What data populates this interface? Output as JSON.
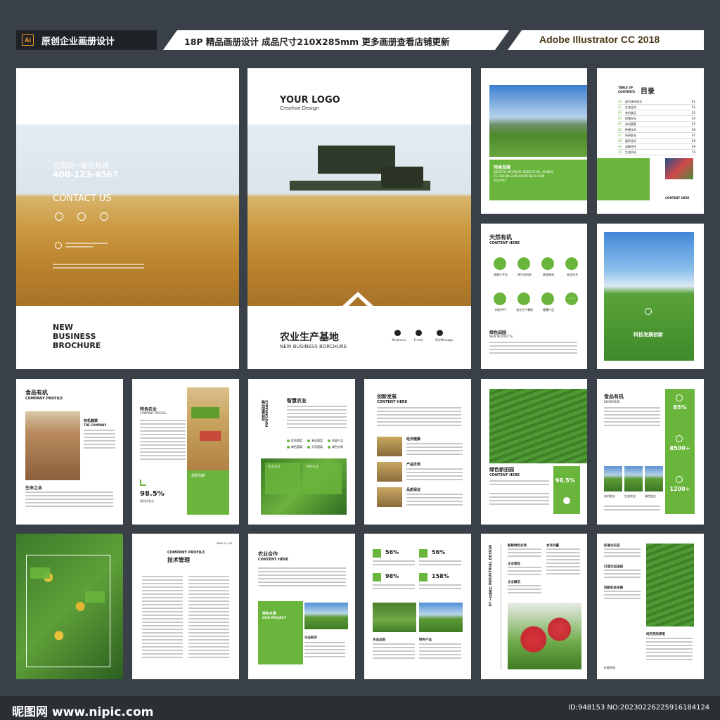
{
  "header": {
    "ai_badge": "Ai",
    "left_title": "原创企业画册设计",
    "middle_title": "18P 精品画册设计  成品尺寸210X285mm  更多画册查看店铺更新",
    "right_title": "Adobe Illustrator CC 2018"
  },
  "pages": {
    "back_cover": {
      "hotline": "全国统一服务热线",
      "phone": "400-123-4567",
      "contact": "CONTACT US",
      "title_line1": "NEW",
      "title_line2": "BUSINESS",
      "title_line3": "BROCHURE"
    },
    "front_cover": {
      "logo": "YOUR LOGO",
      "logo_sub": "Creative Design",
      "title": "农业生产基地",
      "subtitle": "NEW BUSINESS BORCHURE",
      "contact_labels": [
        "Telephone",
        "E-mail",
        "QQ/Message"
      ]
    },
    "p3": {
      "heading": "持续发展",
      "body": "DESITIO NECULPA DEBCATUR, ALIBUS, TE ODION EUM ARUPTIBUS CUM VOLOBE"
    },
    "p4": {
      "label": "TABLE OF CONTENTS",
      "title": "目录",
      "items": [
        "现代休闲农业",
        "生态经济",
        "有机食品",
        "智慧农业",
        "有机蔬菜",
        "种植技术",
        "科研农业",
        "循环经济",
        "战略合作",
        "生态科技"
      ],
      "content_here": "CONTENT HERE"
    },
    "p5": {
      "title": "天然有机",
      "subtitle": "CONTENT HERE",
      "icons": [
        {
          "icon": "leaf-icon",
          "label": "高端大平台"
        },
        {
          "icon": "device-icon",
          "label": "原生态科技"
        },
        {
          "icon": "car-icon",
          "label": "高效物流"
        },
        {
          "icon": "tractor-icon",
          "label": "农业技术"
        },
        {
          "icon": "flask-icon",
          "label": "科技平行"
        },
        {
          "icon": "house-icon",
          "label": "农业生产基地"
        },
        {
          "icon": "gear-icon",
          "label": "健康产品"
        },
        {
          "icon": "more-icon",
          "label": ""
        }
      ],
      "section": "绿色田园",
      "section_sub": "NEW PRODUCTS"
    },
    "p6": {
      "caption": "科技发展创新"
    },
    "p7": {
      "title": "食品有机",
      "subtitle": "COMPANY PROFILE",
      "side_title": "有机蔬菜",
      "side_sub": "THE COMPANY",
      "section": "生命之本"
    },
    "p8": {
      "title": "特色农业",
      "subtitle": "COMPANY PROFILE",
      "stat": "98.5%",
      "stat_label": "高科技农业",
      "caption": "科研创新"
    },
    "p9": {
      "side_title": "非转基因作物",
      "side_sub": "PERFORMANCE",
      "title": "智慧农业",
      "bullets": [
        "优质蔬菜",
        "有机蔬菜",
        "农副产品",
        "绿色蔬菜",
        "天然蔬菜",
        "绿色水果"
      ],
      "box1": "生态农业",
      "box2": "绿色农业"
    },
    "p10": {
      "title": "创新发展",
      "subtitle": "CONTENT HERE",
      "rows": [
        "经济健康",
        "产品优秀",
        "品质保证"
      ]
    },
    "p11": {
      "title": "绿色新田园",
      "subtitle": "CONTENT HERE",
      "stat": "98.5%"
    },
    "p12": {
      "title": "食品有机",
      "subtitle": "REMEMBER",
      "stats": [
        "85%",
        "8500+",
        "1200+"
      ],
      "captions": [
        "有机农业",
        "生态农业",
        "绿色农业"
      ]
    },
    "p13": {},
    "p14": {
      "title1": "COMPANY PROFILE",
      "title2": "技术管理",
      "page_no": "PAGE 01 / 02"
    },
    "p15": {
      "title": "农业合作",
      "subtitle": "CONTENT HERE",
      "box_title": "特色水果",
      "box_sub": "OUR PROJECT",
      "caption": "生态经济"
    },
    "p16": {
      "stats": [
        "56%",
        "56%",
        "98%",
        "158%"
      ],
      "captions": [
        "生态品质",
        "特色产品"
      ]
    },
    "p17": {
      "vertical": "07  工业设计  INDUSTRIAL DESIGN",
      "headings": [
        "新鲜绿色农场",
        "企业理念",
        "企业概况",
        "合作共赢"
      ]
    },
    "p18": {
      "headings": [
        "标准化农田",
        "打造生态田园",
        "创新科技发展",
        "纯天然的享受"
      ],
      "footer": "价值共创"
    }
  },
  "footer": {
    "logo": "昵图网 www.nipic.com",
    "id_text": "ID:948153 NO:20230226225916184124"
  }
}
